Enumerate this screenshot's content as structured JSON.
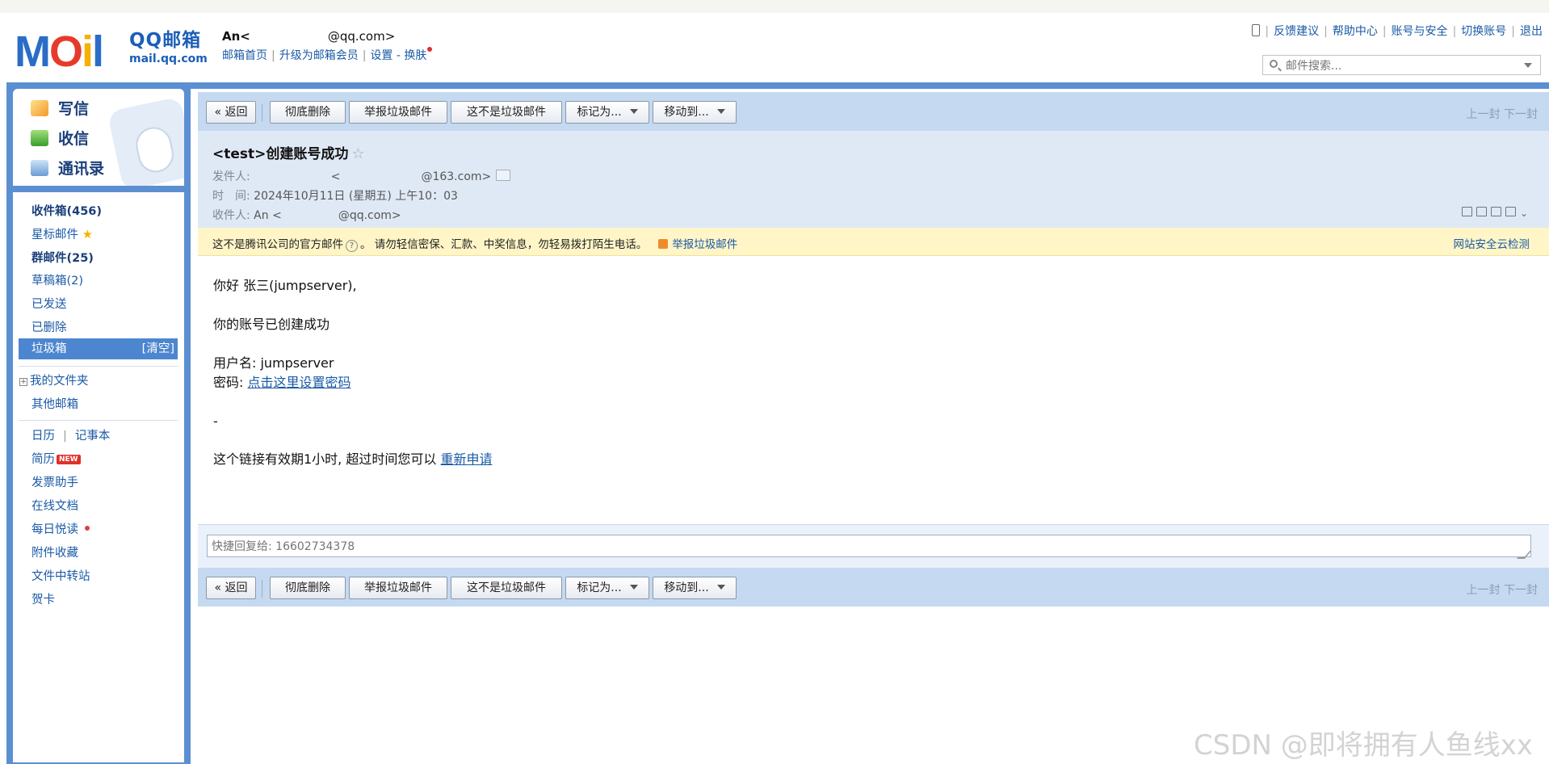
{
  "header": {
    "user_name": "An<",
    "user_email": "@qq.com>",
    "logo_brand": "QQ邮箱",
    "logo_url": "mail.qq.com",
    "links": [
      "邮箱首页",
      "升级为邮箱会员",
      "设置",
      "换肤"
    ],
    "right_links": [
      "反馈建议",
      "帮助中心",
      "账号与安全",
      "切换账号",
      "退出"
    ],
    "search_placeholder": "邮件搜索..."
  },
  "quick_actions": [
    "写信",
    "收信",
    "通讯录"
  ],
  "folders": {
    "inbox": "收件箱(456)",
    "starred": "星标邮件",
    "group": "群邮件(25)",
    "drafts": "草稿箱(2)",
    "sent": "已发送",
    "deleted": "已删除",
    "spam": "垃圾箱",
    "spam_clear": "[清空]",
    "my_folders": "我的文件夹",
    "other_mail": "其他邮箱"
  },
  "tools": {
    "calendar": "日历",
    "notes": "记事本",
    "resume": "简历",
    "new_badge": "NEW",
    "invoice": "发票助手",
    "docs": "在线文档",
    "daily": "每日悦读",
    "attachments": "附件收藏",
    "transfer": "文件中转站",
    "cards": "贺卡"
  },
  "toolbar": {
    "back": "« 返回",
    "delete": "彻底删除",
    "report_spam": "举报垃圾邮件",
    "not_spam": "这不是垃圾邮件",
    "mark_as": "标记为...",
    "move_to": "移动到...",
    "prev": "上一封",
    "next": "下一封"
  },
  "mail": {
    "subject": "<test>创建账号成功",
    "from_label": "发件人:",
    "from_value": "<",
    "from_email": "@163.com>",
    "time_label": "时　间:",
    "time_value": "2024年10月11日 (星期五) 上午10：03",
    "to_label": "收件人:",
    "to_value": "An <",
    "to_email": "@qq.com>",
    "warning": "这不是腾讯公司的官方邮件",
    "warning2": "。 请勿轻信密保、汇款、中奖信息，勿轻易拨打陌生电话。",
    "report_link": "举报垃圾邮件",
    "safety_check": "网站安全云检测",
    "body": {
      "greeting": "你好 张三(jumpserver),",
      "line1": "你的账号已创建成功",
      "username_label": "用户名: jumpserver",
      "password_label": "密码: ",
      "password_link": "点击这里设置密码",
      "dash": "-",
      "expiry_text": "这个链接有效期1小时, 超过时间您可以 ",
      "expiry_link": "重新申请"
    }
  },
  "reply": {
    "placeholder": "快捷回复给: 16602734378"
  },
  "watermark": "CSDN @即将拥有人鱼线xx",
  "colors": {
    "frame_blue": "#5b8fd1",
    "toolbar_bg": "#c5d9f1",
    "selected_folder": "#4d86d0",
    "warning_bg": "#fff5c7",
    "link": "#1a5aa6"
  }
}
